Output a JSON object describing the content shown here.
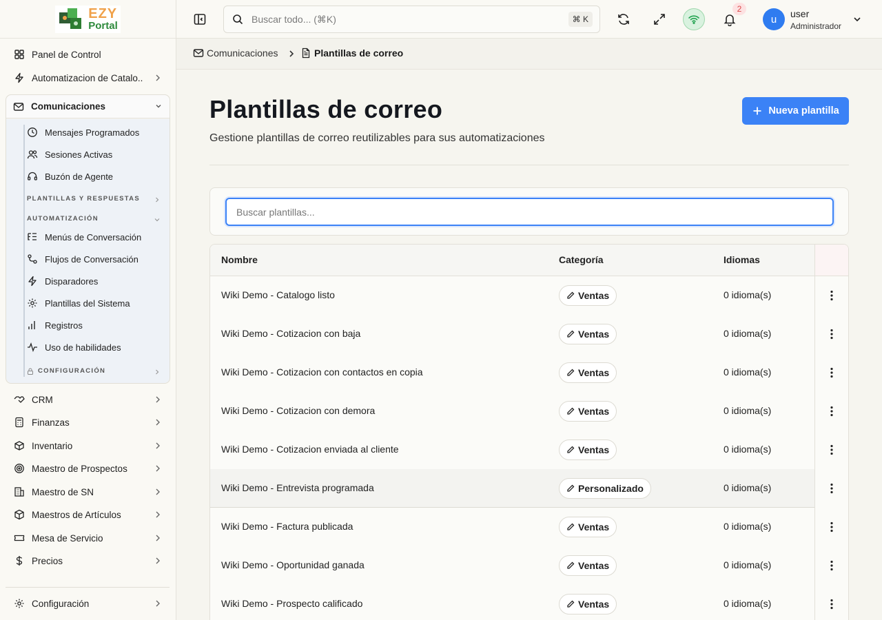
{
  "brand": {
    "name_top": "EZY",
    "name_bottom": "Portal"
  },
  "sidebar": {
    "items_top": [
      {
        "label": "Panel de Control",
        "icon": "dashboard-icon"
      },
      {
        "label": "Automatizacion de Catalo..",
        "icon": "lightning-icon"
      }
    ],
    "group": {
      "label": "Comunicaciones",
      "icon": "mail-icon",
      "items_a": [
        {
          "label": "Mensajes Programados",
          "icon": "clock-icon"
        },
        {
          "label": "Sesiones Activas",
          "icon": "users-icon"
        },
        {
          "label": "Buzón de Agente",
          "icon": "headset-icon"
        }
      ],
      "section_templates": "PLANTILLAS Y RESPUESTAS",
      "section_automation": "AUTOMATIZACIÓN",
      "items_b": [
        {
          "label": "Menús de Conversación",
          "icon": "list-tree-icon"
        },
        {
          "label": "Flujos de Conversación",
          "icon": "flow-icon"
        },
        {
          "label": "Disparadores",
          "icon": "lightning-icon"
        },
        {
          "label": "Plantillas del Sistema",
          "icon": "gear-icon"
        },
        {
          "label": "Registros",
          "icon": "bar-chart-icon"
        },
        {
          "label": "Uso de habilidades",
          "icon": "activity-icon"
        }
      ],
      "section_config": "CONFIGURACIÓN"
    },
    "items_bottom": [
      {
        "label": "CRM",
        "icon": "handshake-icon"
      },
      {
        "label": "Finanzas",
        "icon": "calculator-icon"
      },
      {
        "label": "Inventario",
        "icon": "box-icon"
      },
      {
        "label": "Maestro de Prospectos",
        "icon": "target-icon"
      },
      {
        "label": "Maestro de SN",
        "icon": "building-icon"
      },
      {
        "label": "Maestros de Artículos",
        "icon": "cube-icon"
      },
      {
        "label": "Mesa de Servicio",
        "icon": "ticket-icon"
      },
      {
        "label": "Precios",
        "icon": "dollar-icon"
      }
    ],
    "footer_item": {
      "label": "Configuración",
      "icon": "gear-icon"
    }
  },
  "topbar": {
    "search_placeholder": "Buscar todo... (⌘K)",
    "shortcut": "⌘ K",
    "notifications_count": "2",
    "user_initial": "u",
    "user_name": "user",
    "user_role": "Administrador"
  },
  "breadcrumb": {
    "parent": "Comunicaciones",
    "current": "Plantillas de correo"
  },
  "page": {
    "title": "Plantillas de correo",
    "subtitle": "Gestione plantillas de correo reutilizables para sus automatizaciones",
    "new_button": "Nueva plantilla",
    "filter_placeholder": "Buscar plantillas..."
  },
  "table": {
    "columns": [
      "Nombre",
      "Categoría",
      "Idiomas"
    ],
    "rows": [
      {
        "name": "Wiki Demo - Catalogo listo",
        "category": "Ventas",
        "languages": "0 idioma(s)"
      },
      {
        "name": "Wiki Demo - Cotizacion con baja",
        "category": "Ventas",
        "languages": "0 idioma(s)"
      },
      {
        "name": "Wiki Demo - Cotizacion con contactos en copia",
        "category": "Ventas",
        "languages": "0 idioma(s)"
      },
      {
        "name": "Wiki Demo - Cotizacion con demora",
        "category": "Ventas",
        "languages": "0 idioma(s)"
      },
      {
        "name": "Wiki Demo - Cotizacion enviada al cliente",
        "category": "Ventas",
        "languages": "0 idioma(s)"
      },
      {
        "name": "Wiki Demo - Entrevista programada",
        "category": "Personalizado",
        "languages": "0 idioma(s)"
      },
      {
        "name": "Wiki Demo - Factura publicada",
        "category": "Ventas",
        "languages": "0 idioma(s)"
      },
      {
        "name": "Wiki Demo - Oportunidad ganada",
        "category": "Ventas",
        "languages": "0 idioma(s)"
      },
      {
        "name": "Wiki Demo - Prospecto calificado",
        "category": "Ventas",
        "languages": "0 idioma(s)"
      }
    ]
  },
  "colors": {
    "accent": "#3b82f6",
    "brand_orange": "#f0a14a",
    "brand_green": "#2e8a3c",
    "status_online": "#22a350",
    "badge_red": "#d94a4a"
  }
}
